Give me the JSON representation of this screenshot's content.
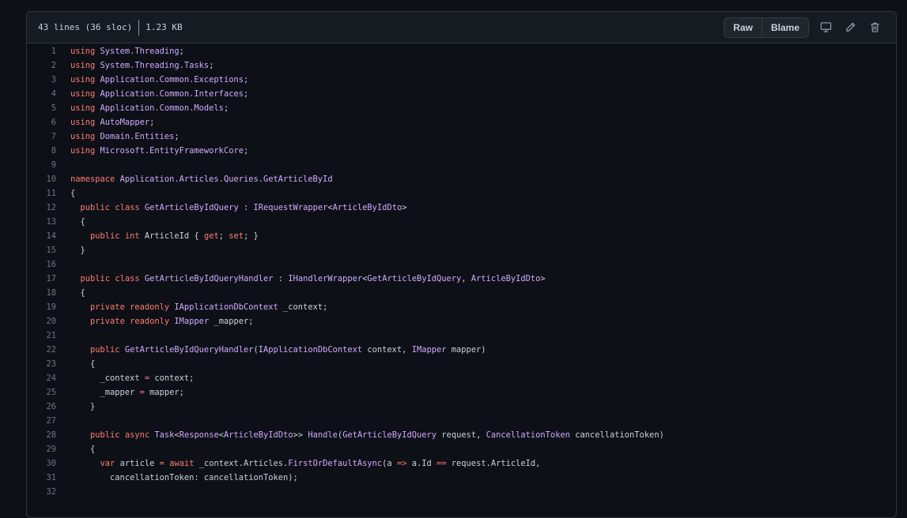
{
  "file_info": {
    "lines": "43 lines (36 sloc)",
    "size": "1.23 KB"
  },
  "toolbar": {
    "raw_label": "Raw",
    "blame_label": "Blame"
  },
  "icons": [
    "desktop-icon",
    "pencil-icon",
    "trash-icon"
  ],
  "colors": {
    "background": "#0d1117",
    "header": "#161b22",
    "keyword": "#ff7b72",
    "type": "#d2a8ff",
    "text": "#c9d1d9",
    "line_number": "#6e7681"
  },
  "code_lines": [
    {
      "n": "1",
      "tokens": [
        [
          "k",
          "using"
        ],
        [
          "p",
          " "
        ],
        [
          "t",
          "System.Threading"
        ],
        [
          "p",
          ";"
        ]
      ]
    },
    {
      "n": "2",
      "tokens": [
        [
          "k",
          "using"
        ],
        [
          "p",
          " "
        ],
        [
          "t",
          "System.Threading.Tasks"
        ],
        [
          "p",
          ";"
        ]
      ]
    },
    {
      "n": "3",
      "tokens": [
        [
          "k",
          "using"
        ],
        [
          "p",
          " "
        ],
        [
          "t",
          "Application.Common.Exceptions"
        ],
        [
          "p",
          ";"
        ]
      ]
    },
    {
      "n": "4",
      "tokens": [
        [
          "k",
          "using"
        ],
        [
          "p",
          " "
        ],
        [
          "t",
          "Application.Common.Interfaces"
        ],
        [
          "p",
          ";"
        ]
      ]
    },
    {
      "n": "5",
      "tokens": [
        [
          "k",
          "using"
        ],
        [
          "p",
          " "
        ],
        [
          "t",
          "Application.Common.Models"
        ],
        [
          "p",
          ";"
        ]
      ]
    },
    {
      "n": "6",
      "tokens": [
        [
          "k",
          "using"
        ],
        [
          "p",
          " "
        ],
        [
          "t",
          "AutoMapper"
        ],
        [
          "p",
          ";"
        ]
      ]
    },
    {
      "n": "7",
      "tokens": [
        [
          "k",
          "using"
        ],
        [
          "p",
          " "
        ],
        [
          "t",
          "Domain.Entities"
        ],
        [
          "p",
          ";"
        ]
      ]
    },
    {
      "n": "8",
      "tokens": [
        [
          "k",
          "using"
        ],
        [
          "p",
          " "
        ],
        [
          "t",
          "Microsoft.EntityFrameworkCore"
        ],
        [
          "p",
          ";"
        ]
      ]
    },
    {
      "n": "9",
      "tokens": []
    },
    {
      "n": "10",
      "tokens": [
        [
          "k",
          "namespace"
        ],
        [
          "p",
          " "
        ],
        [
          "t",
          "Application.Articles.Queries.GetArticleById"
        ]
      ]
    },
    {
      "n": "11",
      "tokens": [
        [
          "p",
          "{"
        ]
      ]
    },
    {
      "n": "12",
      "tokens": [
        [
          "p",
          "  "
        ],
        [
          "k",
          "public"
        ],
        [
          "p",
          " "
        ],
        [
          "k",
          "class"
        ],
        [
          "p",
          " "
        ],
        [
          "t",
          "GetArticleByIdQuery"
        ],
        [
          "p",
          " : "
        ],
        [
          "t",
          "IRequestWrapper"
        ],
        [
          "p",
          "<"
        ],
        [
          "t",
          "ArticleByIdDto"
        ],
        [
          "p",
          ">"
        ]
      ]
    },
    {
      "n": "13",
      "tokens": [
        [
          "p",
          "  {"
        ]
      ]
    },
    {
      "n": "14",
      "tokens": [
        [
          "p",
          "    "
        ],
        [
          "k",
          "public"
        ],
        [
          "p",
          " "
        ],
        [
          "k",
          "int"
        ],
        [
          "p",
          " ArticleId { "
        ],
        [
          "k",
          "get"
        ],
        [
          "p",
          "; "
        ],
        [
          "k",
          "set"
        ],
        [
          "p",
          "; }"
        ]
      ]
    },
    {
      "n": "15",
      "tokens": [
        [
          "p",
          "  }"
        ]
      ]
    },
    {
      "n": "16",
      "tokens": []
    },
    {
      "n": "17",
      "tokens": [
        [
          "p",
          "  "
        ],
        [
          "k",
          "public"
        ],
        [
          "p",
          " "
        ],
        [
          "k",
          "class"
        ],
        [
          "p",
          " "
        ],
        [
          "t",
          "GetArticleByIdQueryHandler"
        ],
        [
          "p",
          " : "
        ],
        [
          "t",
          "IHandlerWrapper"
        ],
        [
          "p",
          "<"
        ],
        [
          "t",
          "GetArticleByIdQuery"
        ],
        [
          "p",
          ", "
        ],
        [
          "t",
          "ArticleByIdDto"
        ],
        [
          "p",
          ">"
        ]
      ]
    },
    {
      "n": "18",
      "tokens": [
        [
          "p",
          "  {"
        ]
      ]
    },
    {
      "n": "19",
      "tokens": [
        [
          "p",
          "    "
        ],
        [
          "k",
          "private"
        ],
        [
          "p",
          " "
        ],
        [
          "k",
          "readonly"
        ],
        [
          "p",
          " "
        ],
        [
          "t",
          "IApplicationDbContext"
        ],
        [
          "p",
          " _context;"
        ]
      ]
    },
    {
      "n": "20",
      "tokens": [
        [
          "p",
          "    "
        ],
        [
          "k",
          "private"
        ],
        [
          "p",
          " "
        ],
        [
          "k",
          "readonly"
        ],
        [
          "p",
          " "
        ],
        [
          "t",
          "IMapper"
        ],
        [
          "p",
          " _mapper;"
        ]
      ]
    },
    {
      "n": "21",
      "tokens": []
    },
    {
      "n": "22",
      "tokens": [
        [
          "p",
          "    "
        ],
        [
          "k",
          "public"
        ],
        [
          "p",
          " "
        ],
        [
          "t",
          "GetArticleByIdQueryHandler"
        ],
        [
          "p",
          "("
        ],
        [
          "t",
          "IApplicationDbContext"
        ],
        [
          "p",
          " context, "
        ],
        [
          "t",
          "IMapper"
        ],
        [
          "p",
          " mapper)"
        ]
      ]
    },
    {
      "n": "23",
      "tokens": [
        [
          "p",
          "    {"
        ]
      ]
    },
    {
      "n": "24",
      "tokens": [
        [
          "p",
          "      _context "
        ],
        [
          "k",
          "="
        ],
        [
          "p",
          " context;"
        ]
      ]
    },
    {
      "n": "25",
      "tokens": [
        [
          "p",
          "      _mapper "
        ],
        [
          "k",
          "="
        ],
        [
          "p",
          " mapper;"
        ]
      ]
    },
    {
      "n": "26",
      "tokens": [
        [
          "p",
          "    }"
        ]
      ]
    },
    {
      "n": "27",
      "tokens": []
    },
    {
      "n": "28",
      "tokens": [
        [
          "p",
          "    "
        ],
        [
          "k",
          "public"
        ],
        [
          "p",
          " "
        ],
        [
          "k",
          "async"
        ],
        [
          "p",
          " "
        ],
        [
          "t",
          "Task"
        ],
        [
          "p",
          "<"
        ],
        [
          "t",
          "Response"
        ],
        [
          "p",
          "<"
        ],
        [
          "t",
          "ArticleByIdDto"
        ],
        [
          "p",
          ">> "
        ],
        [
          "t",
          "Handle"
        ],
        [
          "p",
          "("
        ],
        [
          "t",
          "GetArticleByIdQuery"
        ],
        [
          "p",
          " request, "
        ],
        [
          "t",
          "CancellationToken"
        ],
        [
          "p",
          " cancellationToken)"
        ]
      ]
    },
    {
      "n": "29",
      "tokens": [
        [
          "p",
          "    {"
        ]
      ]
    },
    {
      "n": "30",
      "tokens": [
        [
          "p",
          "      "
        ],
        [
          "k",
          "var"
        ],
        [
          "p",
          " article "
        ],
        [
          "k",
          "="
        ],
        [
          "p",
          " "
        ],
        [
          "k",
          "await"
        ],
        [
          "p",
          " _context.Articles."
        ],
        [
          "t",
          "FirstOrDefaultAsync"
        ],
        [
          "p",
          "(a "
        ],
        [
          "k",
          "=>"
        ],
        [
          "p",
          " a.Id "
        ],
        [
          "k",
          "=="
        ],
        [
          "p",
          " request.ArticleId,"
        ]
      ]
    },
    {
      "n": "31",
      "tokens": [
        [
          "p",
          "        cancellationToken: cancellationToken);"
        ]
      ]
    },
    {
      "n": "32",
      "tokens": []
    }
  ]
}
